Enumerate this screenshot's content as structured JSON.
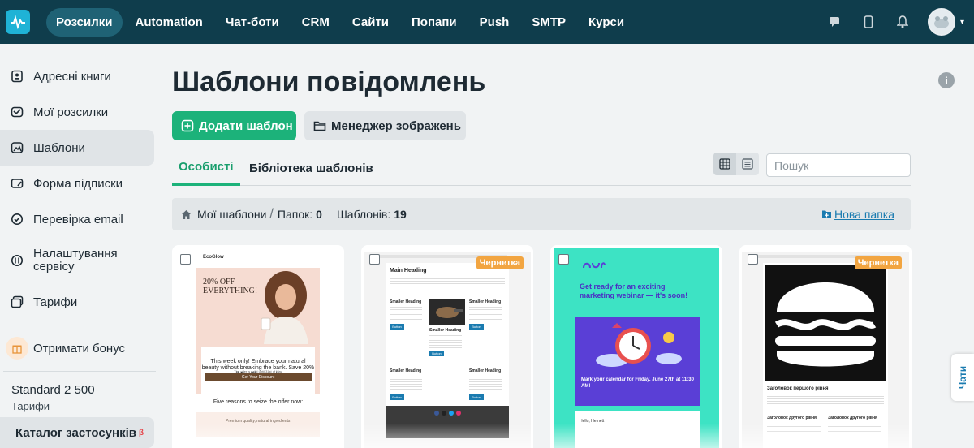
{
  "nav": {
    "items": [
      "Розсилки",
      "Automation",
      "Чат-боти",
      "CRM",
      "Сайти",
      "Попапи",
      "Push",
      "SMTP",
      "Курси"
    ],
    "active_index": 0,
    "right_icons": [
      "chat-icon",
      "mobile-icon",
      "bell-icon"
    ],
    "accent": "#0f3d4c"
  },
  "sidebar": {
    "items": [
      {
        "label": "Адресні книги",
        "icon": "address-book-icon"
      },
      {
        "label": "Мої розсилки",
        "icon": "mailbox-icon"
      },
      {
        "label": "Шаблони",
        "icon": "templates-icon",
        "active": true
      },
      {
        "label": "Форма підписки",
        "icon": "form-icon"
      },
      {
        "label": "Перевірка email",
        "icon": "check-email-icon"
      },
      {
        "label": "Налаштування сервісу",
        "icon": "settings-icon"
      },
      {
        "label": "Тарифи",
        "icon": "tariffs-icon"
      }
    ],
    "bonus_label": "Отримати бонус",
    "plan_name": "Standard 2 500",
    "plan_sub": "Тарифи",
    "catalog_label": "Каталог застосунків",
    "catalog_badge": "β"
  },
  "main": {
    "title": "Шаблони повідомлень",
    "add_button": "Додати шаблон",
    "media_button": "Менеджер зображень",
    "tabs": [
      "Особисті",
      "Бібліотека шаблонів"
    ],
    "active_tab": 0,
    "search_placeholder": "Пошук",
    "breadcrumb": {
      "root": "Мої шаблони",
      "separator": "/",
      "folders_label": "Папок:",
      "folders_count": "0",
      "templates_label": "Шаблонів:",
      "templates_count": "19",
      "new_folder": "Нова папка"
    }
  },
  "cards": [
    {
      "draft": false,
      "brand": "EcoGlow",
      "headline": "20% OFF EVERYTHING!",
      "body": "This week only! Embrace your natural beauty without breaking the bank. Save 20% on all EcoGlow purchases",
      "note": "The offer is valid until 31st of May",
      "cta": "Get Your Discount",
      "section": "Five reasons to seize the offer now:",
      "item": "Premium quality, natural ingredients"
    },
    {
      "draft": true,
      "badge": "Чернетка",
      "heading": "Main Heading",
      "sub1": "Smaller Heading",
      "sub2": "Smaller Heading",
      "sub3": "Smaller Heading",
      "button": "Button"
    },
    {
      "draft": false,
      "headline": "Get ready for an exciting marketing webinar — it's soon!",
      "calendar": "Mark your calendar for Friday, June 27th at 11:30 AM!",
      "greeting": "Hello, Hemett",
      "color": "#3de3c4"
    },
    {
      "draft": true,
      "badge": "Чернетка",
      "heading": "Заголовок першого рівня",
      "sub": "Заголовок другого рівня"
    }
  ],
  "chats_tab": "Чати"
}
